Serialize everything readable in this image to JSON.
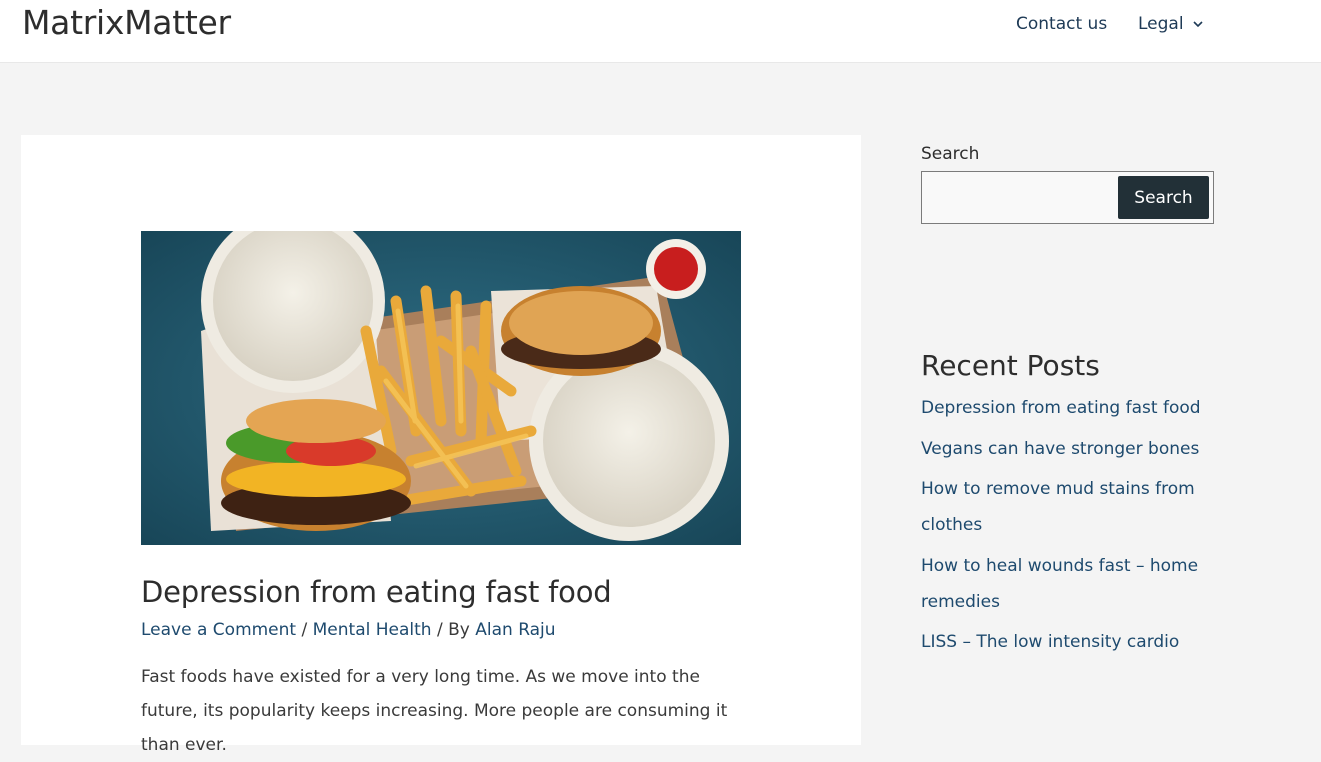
{
  "site": {
    "title": "MatrixMatter"
  },
  "nav": {
    "contact": "Contact us",
    "legal": "Legal"
  },
  "post": {
    "title": "Depression from eating fast food",
    "meta": {
      "comment": "Leave a Comment",
      "sep1": " / ",
      "category": "Mental Health",
      "sep2": " / By ",
      "author": "Alan Raju"
    },
    "excerpt": "Fast foods have existed for a very long time. As we move into the future, its popularity keeps increasing. More people are consuming it than ever."
  },
  "sidebar": {
    "search_label": "Search",
    "search_button": "Search",
    "search_value": "",
    "recent_heading": "Recent Posts",
    "recent_posts": [
      "Depression from eating fast food",
      "Vegans can have stronger bones",
      "How to remove mud stains from clothes",
      "How to heal wounds fast – home remedies",
      "LISS – The low intensity cardio"
    ]
  },
  "colors": {
    "link": "#1e4a6e",
    "nav": "#1e3a56",
    "button": "#223037",
    "background": "#f4f4f4"
  },
  "icons": {
    "nav_dropdown": "chevron-down-icon"
  }
}
